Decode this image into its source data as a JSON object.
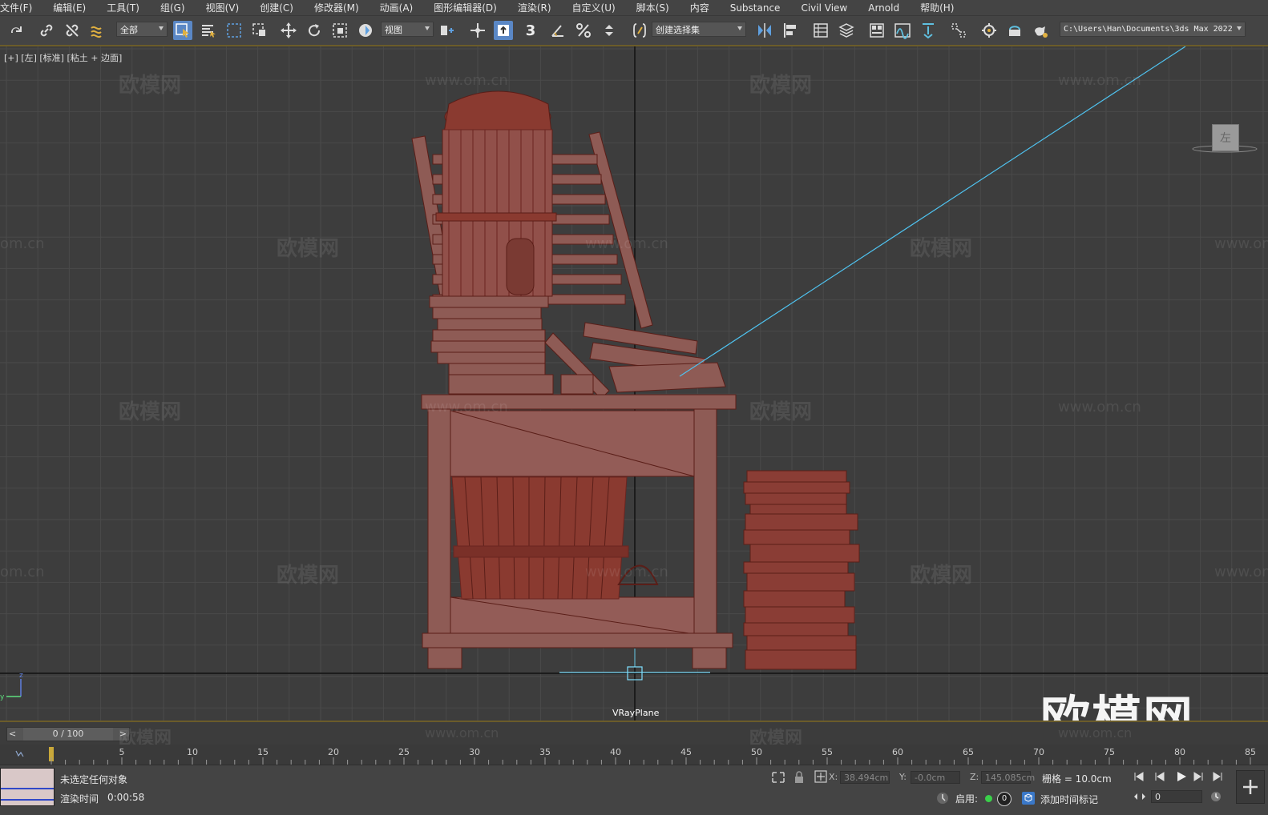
{
  "menu": [
    "文件(F)",
    "编辑(E)",
    "工具(T)",
    "组(G)",
    "视图(V)",
    "创建(C)",
    "修改器(M)",
    "动画(A)",
    "图形编辑器(D)",
    "渲染(R)",
    "自定义(U)",
    "脚本(S)",
    "内容",
    "Substance",
    "Civil View",
    "Arnold",
    "帮助(H)"
  ],
  "toolbar": {
    "filter_value": "全部",
    "refcoord_value": "视图",
    "selection_set_value": "创建选择集",
    "snap_value": "3",
    "project_path": "C:\\Users\\Han\\Documents\\3ds Max 2022"
  },
  "viewport": {
    "label": "[+] [左] [标准] [粘土 + 边面]",
    "object_label": "VRayPlane",
    "viewcube_face": "左",
    "watermark_cn": "欧模网",
    "watermark_url": "www.om.cn",
    "watermark_url_short": "om.cn",
    "watermark_big": "欧模网",
    "axis_z": "z",
    "axis_y": "y"
  },
  "timeline": {
    "frame_display": "0 / 100",
    "prev": "<",
    "next": ">",
    "ticks": [
      "5",
      "10",
      "15",
      "20",
      "25",
      "30",
      "35",
      "40",
      "45",
      "50",
      "55",
      "60",
      "65",
      "70",
      "75",
      "80",
      "85"
    ]
  },
  "status": {
    "selection": "未选定任何对象",
    "render_time_label": "渲染时间",
    "render_time_value": "0:00:58",
    "x_label": "X:",
    "x_value": "38.494cm",
    "y_label": "Y:",
    "y_value": "-0.0cm",
    "z_label": "Z:",
    "z_value": "145.085cm",
    "grid_label": "栅格 = 10.0cm",
    "enable_label": "启用:",
    "enable_count": "0",
    "add_time_tag": "添加时间标记",
    "frame_field": "0"
  },
  "colors": {
    "wire": "#7a2a22",
    "mesh": "#8e5b55",
    "active": "#5a87c5",
    "accent": "#d6b45a"
  }
}
